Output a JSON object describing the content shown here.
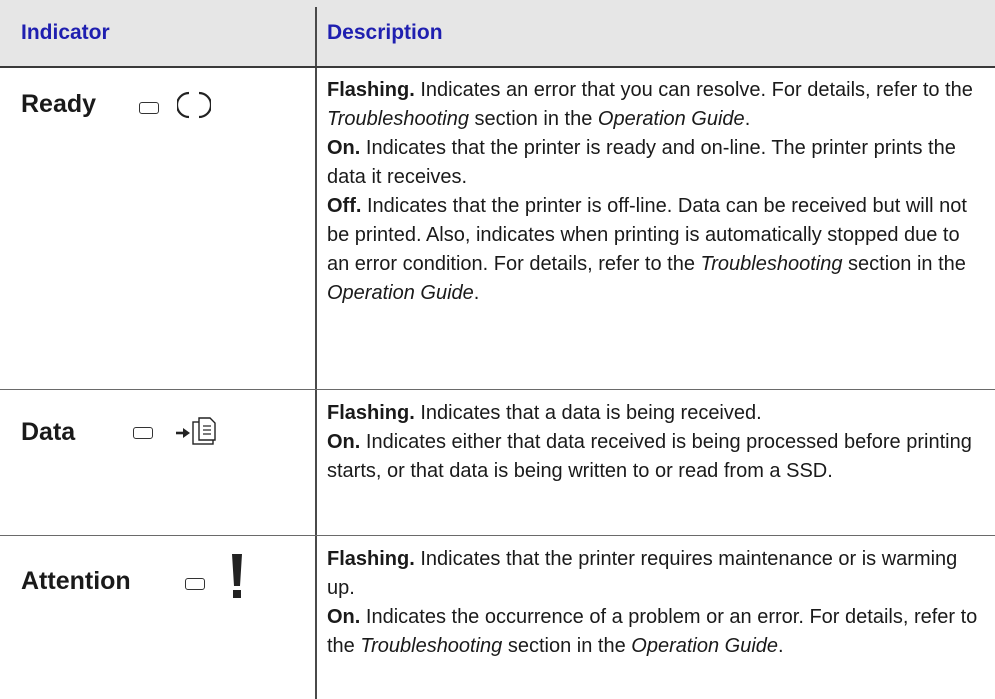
{
  "header": {
    "indicator": "Indicator",
    "description": "Description"
  },
  "rows": [
    {
      "label": "Ready",
      "paragraphs": [
        [
          {
            "t": "Flashing.",
            "s": "b"
          },
          {
            "t": " Indicates an error that you can resolve. For details, refer to the "
          },
          {
            "t": "Troubleshooting",
            "s": "i"
          },
          {
            "t": " section in the "
          },
          {
            "t": "Operation Guide",
            "s": "i"
          },
          {
            "t": "."
          }
        ],
        [
          {
            "t": "On.",
            "s": "b"
          },
          {
            "t": " Indicates that the printer is ready and on-line. The printer prints the data it receives."
          }
        ],
        [
          {
            "t": "Off.",
            "s": "b"
          },
          {
            "t": " Indicates that the printer is off-line. Data can be received but will not be printed. Also, indicates when printing is automatically stopped due to an error condition. For details, refer to the "
          },
          {
            "t": "Troubleshooting",
            "s": "i"
          },
          {
            "t": " section in the "
          },
          {
            "t": "Operation Guide",
            "s": "i"
          },
          {
            "t": "."
          }
        ]
      ]
    },
    {
      "label": "Data",
      "paragraphs": [
        [
          {
            "t": "Flashing.",
            "s": "b"
          },
          {
            "t": " Indicates that a data is being received."
          }
        ],
        [
          {
            "t": "On.",
            "s": "b"
          },
          {
            "t": " Indicates either that data received is being processed before printing starts, or that data is being written to or read from a SSD."
          }
        ]
      ]
    },
    {
      "label": "Attention",
      "paragraphs": [
        [
          {
            "t": "Flashing.",
            "s": "b"
          },
          {
            "t": " Indicates that the printer requires maintenance or is warming up."
          }
        ],
        [
          {
            "t": "On.",
            "s": "b"
          },
          {
            "t": " Indicates the occurrence of a problem or an error. For details, refer to the "
          },
          {
            "t": "Troubleshooting",
            "s": "i"
          },
          {
            "t": " section in the "
          },
          {
            "t": "Operation Guide",
            "s": "i"
          },
          {
            "t": "."
          }
        ]
      ]
    }
  ]
}
